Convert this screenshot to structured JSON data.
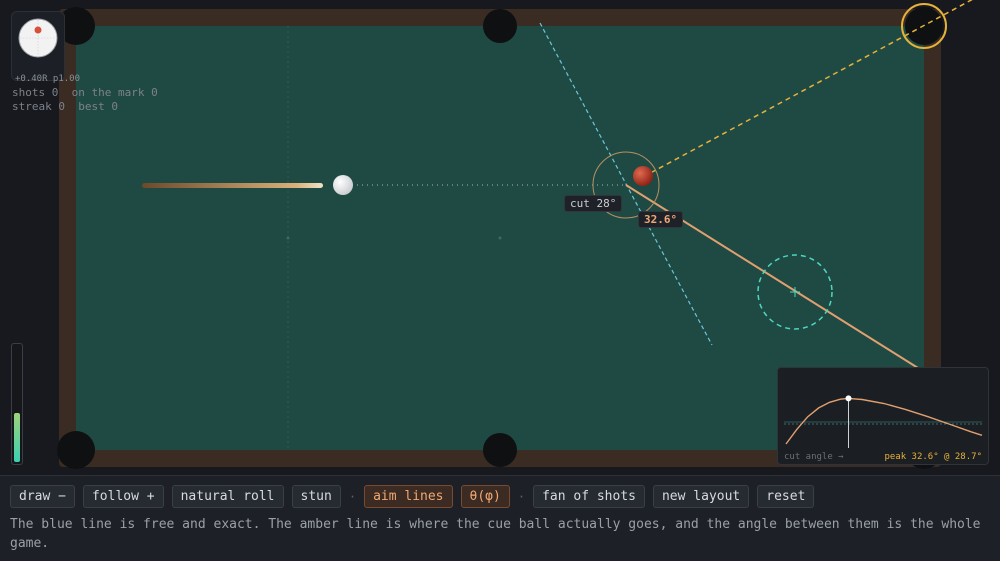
{
  "spin": {
    "readout": "+0.40R  p1.00"
  },
  "stats": {
    "line1": "shots 0  on the mark 0",
    "line2": "streak 0  best 0"
  },
  "power": {
    "level": 0.42
  },
  "overlay": {
    "cut_label": "cut 28°",
    "throw_angle": "32.6°"
  },
  "mini_chart": {
    "label": "cut angle →",
    "peak": "peak 32.6° @ 28.7°",
    "chart_data": {
      "type": "line",
      "x": [
        0,
        5,
        10,
        15,
        20,
        25,
        28.7,
        35,
        45,
        55,
        65,
        75,
        85,
        90
      ],
      "values": [
        0,
        10.5,
        19.5,
        25.8,
        29.8,
        32.0,
        32.6,
        31.8,
        28.9,
        24.6,
        19.6,
        14.2,
        8.7,
        6.2
      ],
      "marker_x": 28.7,
      "xlim": [
        0,
        90
      ],
      "ylim": [
        0,
        40
      ],
      "xlabel": "cut angle →"
    }
  },
  "toolbar": {
    "buttons": [
      {
        "label": "draw −",
        "active": false
      },
      {
        "label": "follow +",
        "active": false
      },
      {
        "label": "natural roll",
        "active": false
      },
      {
        "label": "stun",
        "active": false
      },
      {
        "label": "aim lines",
        "active": true
      },
      {
        "label": "θ(φ)",
        "active": true
      },
      {
        "label": "fan of shots",
        "active": false
      },
      {
        "label": "new layout",
        "active": false
      },
      {
        "label": "reset",
        "active": false
      }
    ],
    "separator": "·"
  },
  "caption": "The blue line is free and exact. The amber line is where the cue ball actually goes, and the angle between them is the whole game.",
  "colors": {
    "felt": "#1f4a44",
    "rail": "#3a2c22",
    "aim_line": "#6ec6d8",
    "path_line": "#e0a070",
    "target_line": "#e7b23a",
    "ghost": "#4fd6c0"
  }
}
